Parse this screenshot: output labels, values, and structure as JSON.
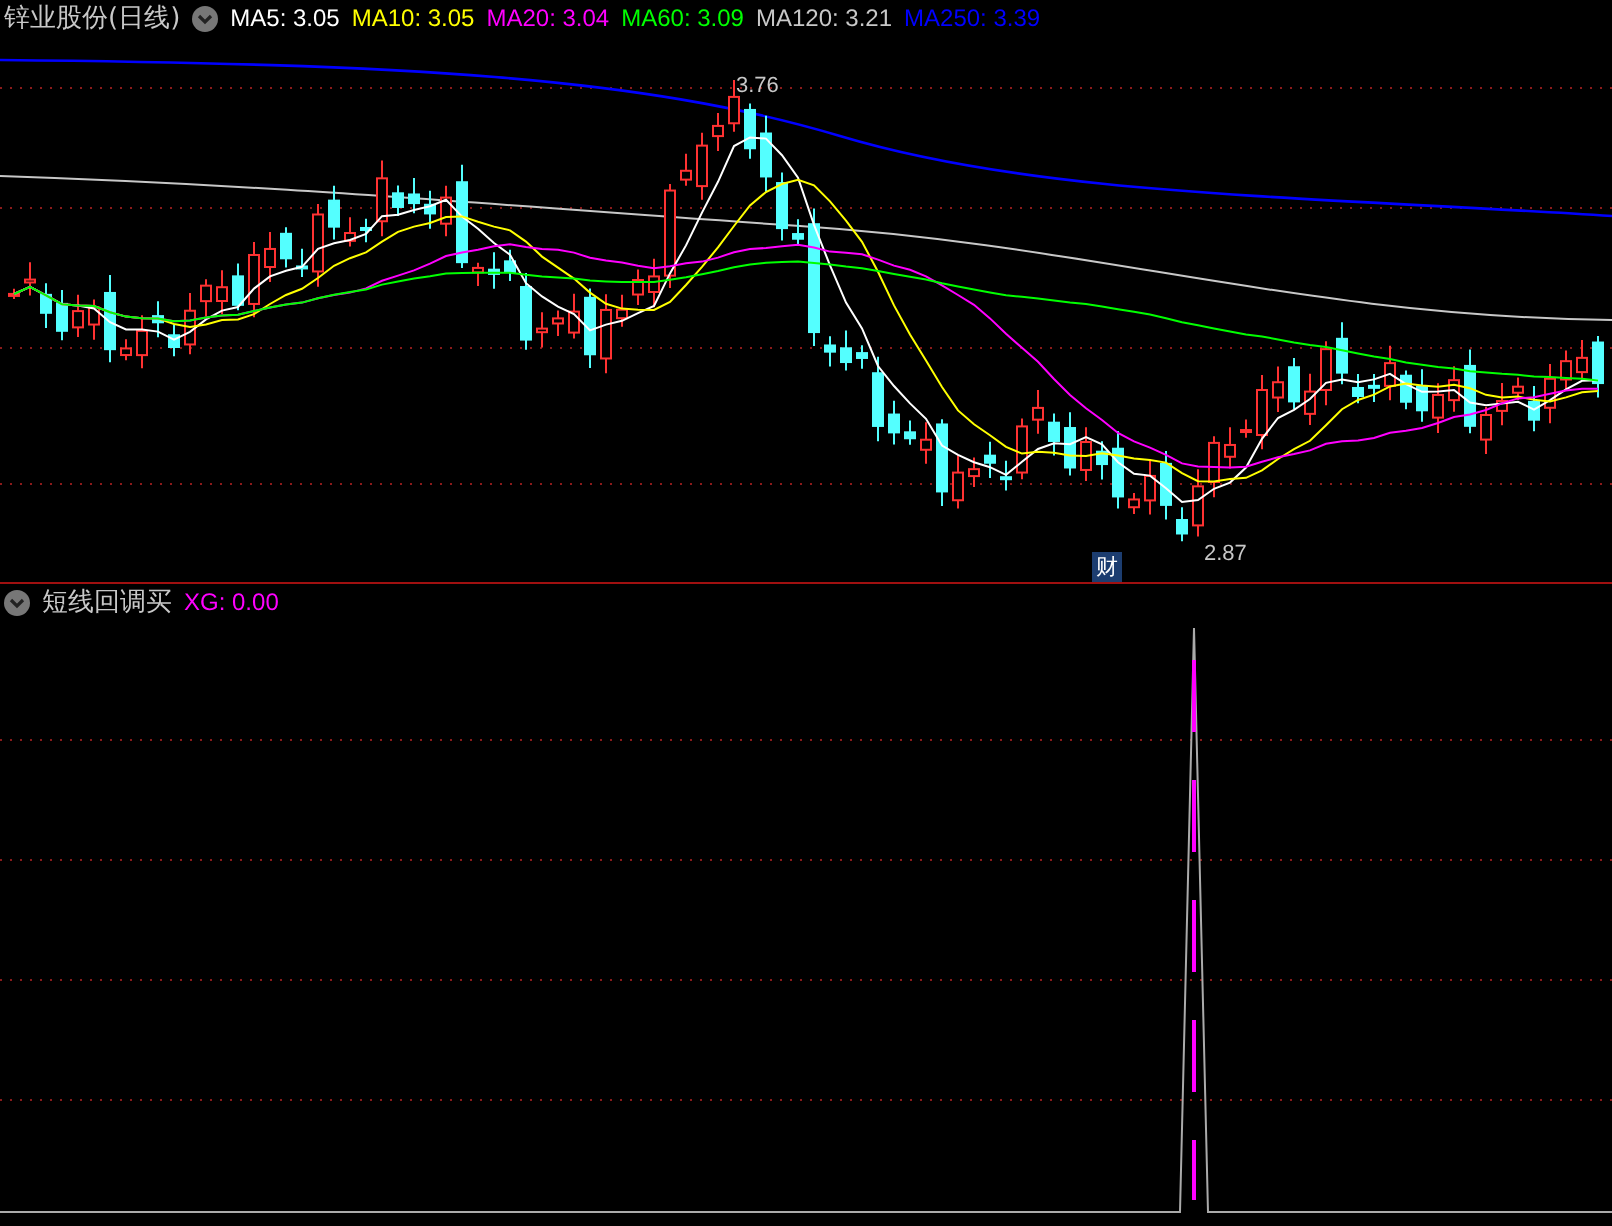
{
  "chart_header": {
    "title": "锌业股份(日线)",
    "ma_legend": [
      {
        "label": "MA5: 3.05",
        "color": "#ffffff"
      },
      {
        "label": "MA10: 3.05",
        "color": "#ffff00"
      },
      {
        "label": "MA20: 3.04",
        "color": "#ff00ff"
      },
      {
        "label": "MA60: 3.09",
        "color": "#00ff00"
      },
      {
        "label": "MA120: 3.21",
        "color": "#c8c8c8"
      },
      {
        "label": "MA250: 3.39",
        "color": "#0000ff"
      }
    ]
  },
  "price_chart": {
    "high_label": "3.76",
    "low_label": "2.87",
    "badge": "财"
  },
  "indicator_header": {
    "name": "短线回调买",
    "reading": "XG: 0.00"
  }
}
